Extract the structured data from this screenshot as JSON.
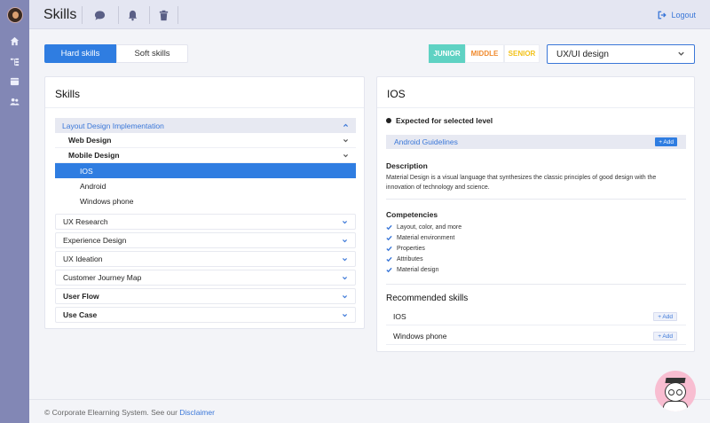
{
  "header": {
    "title": "Skills",
    "logout_label": "Logout"
  },
  "tabs": [
    {
      "label": "Hard skills",
      "active": true
    },
    {
      "label": "Soft skills",
      "active": false
    }
  ],
  "levels": [
    {
      "label": "JUNIOR",
      "color": "#5fd2c3"
    },
    {
      "label": "MIDDLE",
      "color": "#f08a2e"
    },
    {
      "label": "SENIOR",
      "color": "#f2c21a"
    }
  ],
  "selector": {
    "value": "UX/UI design"
  },
  "left_panel": {
    "title": "Skills",
    "tree": {
      "group": "Layout Design Implementation",
      "subgroups": [
        {
          "label": "Web Design"
        },
        {
          "label": "Mobile Design",
          "children": [
            "IOS",
            "Android",
            "Windows phone"
          ],
          "selected": "IOS"
        }
      ],
      "items": [
        "UX Research",
        "Experience Design",
        "UX Ideation",
        "Customer Journey Map",
        "User Flow",
        "Use Case"
      ]
    }
  },
  "right_panel": {
    "title": "IOS",
    "expected_label": "Expected for selected level",
    "guideline": "Android Guidelines",
    "add_label": "+ Add",
    "description_title": "Description",
    "description": "Material Design is a visual language that synthesizes the classic principles of good design with the innovation of technology and science.",
    "competencies_title": "Competencies",
    "competencies": [
      "Layout, color, and more",
      "Material environment",
      "Properties",
      "Attributes",
      "Material design"
    ],
    "recommended_title": "Recommended skills",
    "recommended": [
      "IOS",
      "Windows phone"
    ]
  },
  "footer": {
    "text": "Corporate Elearning System.  See our ",
    "link": "Disclaimer"
  },
  "colors": {
    "accent": "#2f7de1",
    "rail": "#8287b5"
  }
}
